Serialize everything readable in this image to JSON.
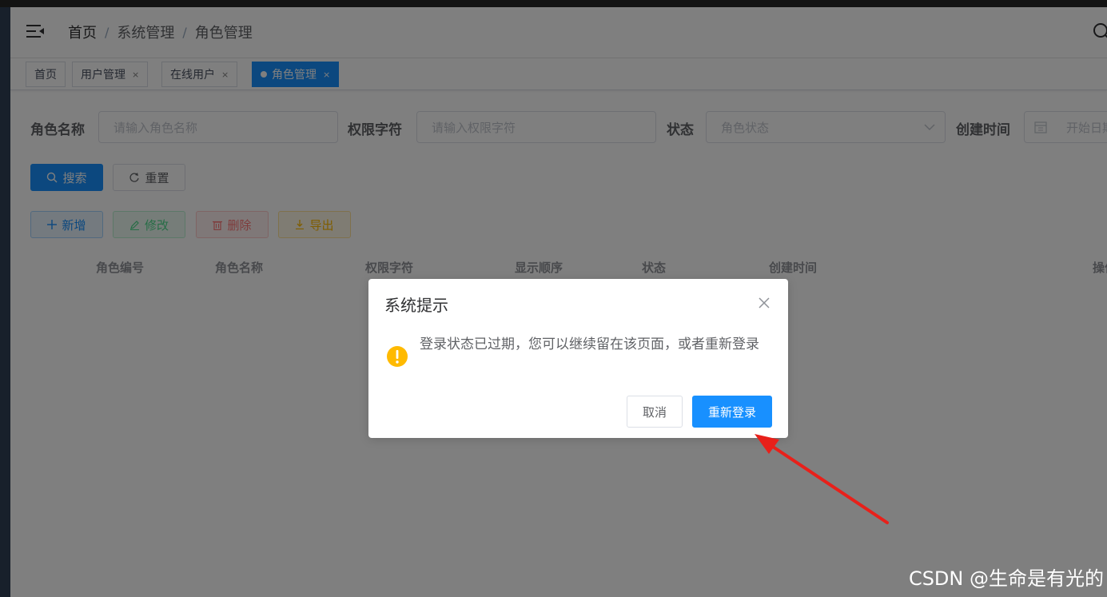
{
  "navbar": {
    "breadcrumb": [
      "首页",
      "系统管理",
      "角色管理"
    ],
    "separator": "/"
  },
  "tags": [
    {
      "label": "首页",
      "closable": false,
      "active": false
    },
    {
      "label": "用户管理",
      "closable": true,
      "active": false
    },
    {
      "label": "在线用户",
      "closable": true,
      "active": false
    },
    {
      "label": "角色管理",
      "closable": true,
      "active": true
    }
  ],
  "tag_close": "×",
  "search_form": {
    "role_name_label": "角色名称",
    "role_name_placeholder": "请输入角色名称",
    "role_key_label": "权限字符",
    "role_key_placeholder": "请输入权限字符",
    "status_label": "状态",
    "status_placeholder": "角色状态",
    "create_time_label": "创建时间",
    "start_date_placeholder": "开始日期"
  },
  "buttons": {
    "search": "搜索",
    "reset": "重置",
    "add": "新增",
    "edit": "修改",
    "delete": "删除",
    "export": "导出"
  },
  "table": {
    "columns": [
      "角色编号",
      "角色名称",
      "权限字符",
      "显示顺序",
      "状态",
      "创建时间",
      "操作"
    ]
  },
  "dialog": {
    "title": "系统提示",
    "message": "登录状态已过期，您可以继续留在该页面，或者重新登录",
    "cancel": "取消",
    "confirm": "重新登录"
  },
  "watermark": "CSDN @生命是有光的",
  "colors": {
    "primary": "#1890ff",
    "warning": "#ffba00",
    "annotation_arrow": "#e8201a",
    "sidebar": "#304156"
  }
}
